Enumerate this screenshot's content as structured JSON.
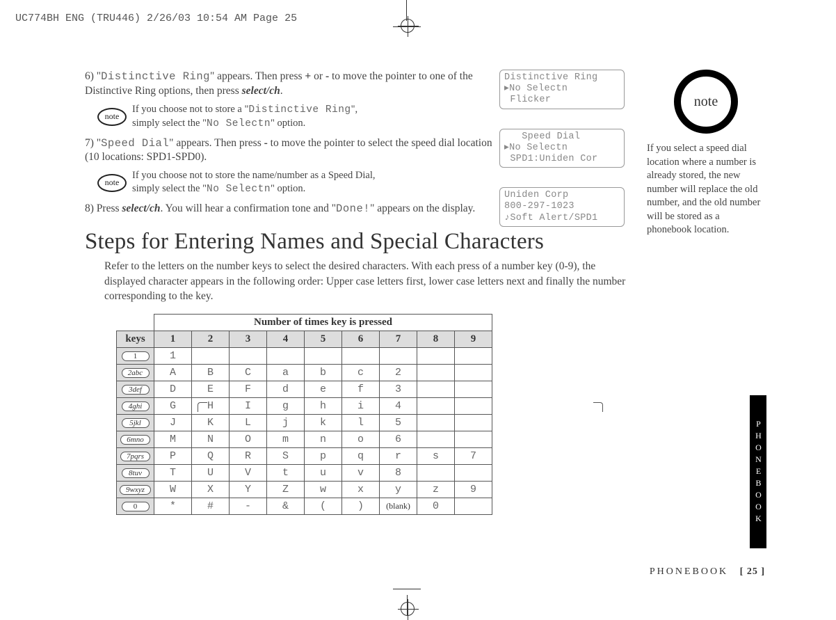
{
  "header": "UC774BH ENG (TRU446)  2/26/03  10:54 AM  Page 25",
  "steps": {
    "s6_a": "6) \"",
    "s6_lcd": "Distinctive Ring",
    "s6_b": "\" appears. Then press ",
    "s6_plus": "+",
    "s6_or": " or ",
    "s6_minus": "-",
    "s6_c": " to move the pointer to one of the Distinctive Ring options, then press ",
    "s6_key": "select/ch",
    "s6_d": ".",
    "note1_a": "If you choose not to store a \"",
    "note1_lcd": "Distinctive Ring",
    "note1_b": "\",\nsimply select the \"",
    "note1_lcd2": "No Selectn",
    "note1_c": "\" option.",
    "s7_a": "7) \"",
    "s7_lcd": "Speed Dial",
    "s7_b": "\" appears. Then press ",
    "s7_minus": "-",
    "s7_c": " to move the pointer to select the speed dial location (10 locations: SPD1-SPD0).",
    "note2_a": "If you choose not to store the name/number as a Speed Dial,\nsimply select the \"",
    "note2_lcd": "No Selectn",
    "note2_b": "\" option.",
    "s8_a": "8) Press ",
    "s8_key": "select/ch",
    "s8_b": ". You will hear a confirmation tone and \"",
    "s8_lcd": "Done!",
    "s8_c": "\" appears on the display."
  },
  "note_label": "note",
  "screens": {
    "sc1": "Distinctive Ring\n▸No Selectn\n Flicker",
    "sc2": "   Speed Dial\n▸No Selectn\n SPD1:Uniden Cor",
    "sc3": "Uniden Corp\n800-297-1023\n♪Soft Alert/SPD1"
  },
  "side_note": "If you select a speed dial location where a number is already stored, the new number will replace the old number, and the old number will be stored as a phonebook location.",
  "section_title": "Steps for Entering Names and Special Characters",
  "section_intro": "Refer to the letters on the number keys to select the desired characters. With each press of a number key (0-9), the displayed character appears in the following order: Upper case letters first, lower case letters next and finally the number corresponding to the key.",
  "table_header": "Number of times key is pressed",
  "cols": [
    "keys",
    "1",
    "2",
    "3",
    "4",
    "5",
    "6",
    "7",
    "8",
    "9"
  ],
  "chart_data": {
    "type": "table",
    "title": "Number of times key is pressed",
    "columns": [
      "keys",
      "1",
      "2",
      "3",
      "4",
      "5",
      "6",
      "7",
      "8",
      "9"
    ],
    "rows": [
      {
        "key": "1",
        "values": [
          "1",
          "",
          "",
          "",
          "",
          "",
          "",
          "",
          ""
        ]
      },
      {
        "key": "2abc",
        "values": [
          "A",
          "B",
          "C",
          "a",
          "b",
          "c",
          "2",
          "",
          ""
        ]
      },
      {
        "key": "3def",
        "values": [
          "D",
          "E",
          "F",
          "d",
          "e",
          "f",
          "3",
          "",
          ""
        ]
      },
      {
        "key": "4ghi",
        "values": [
          "G",
          "H",
          "I",
          "g",
          "h",
          "i",
          "4",
          "",
          ""
        ]
      },
      {
        "key": "5jkl",
        "values": [
          "J",
          "K",
          "L",
          "j",
          "k",
          "l",
          "5",
          "",
          ""
        ]
      },
      {
        "key": "6mno",
        "values": [
          "M",
          "N",
          "O",
          "m",
          "n",
          "o",
          "6",
          "",
          ""
        ]
      },
      {
        "key": "7pqrs",
        "values": [
          "P",
          "Q",
          "R",
          "S",
          "p",
          "q",
          "r",
          "s",
          "7"
        ]
      },
      {
        "key": "8tuv",
        "values": [
          "T",
          "U",
          "V",
          "t",
          "u",
          "v",
          "8",
          "",
          ""
        ]
      },
      {
        "key": "9wxyz",
        "values": [
          "W",
          "X",
          "Y",
          "Z",
          "w",
          "x",
          "y",
          "z",
          "9"
        ]
      },
      {
        "key": "0",
        "values": [
          "*",
          "#",
          "-",
          "&",
          "(",
          ")",
          "(blank)",
          "0",
          ""
        ]
      }
    ]
  },
  "footer_label": "PHONEBOOK",
  "footer_page": "[ 25 ]",
  "side_tab": "PHONEBOOK"
}
